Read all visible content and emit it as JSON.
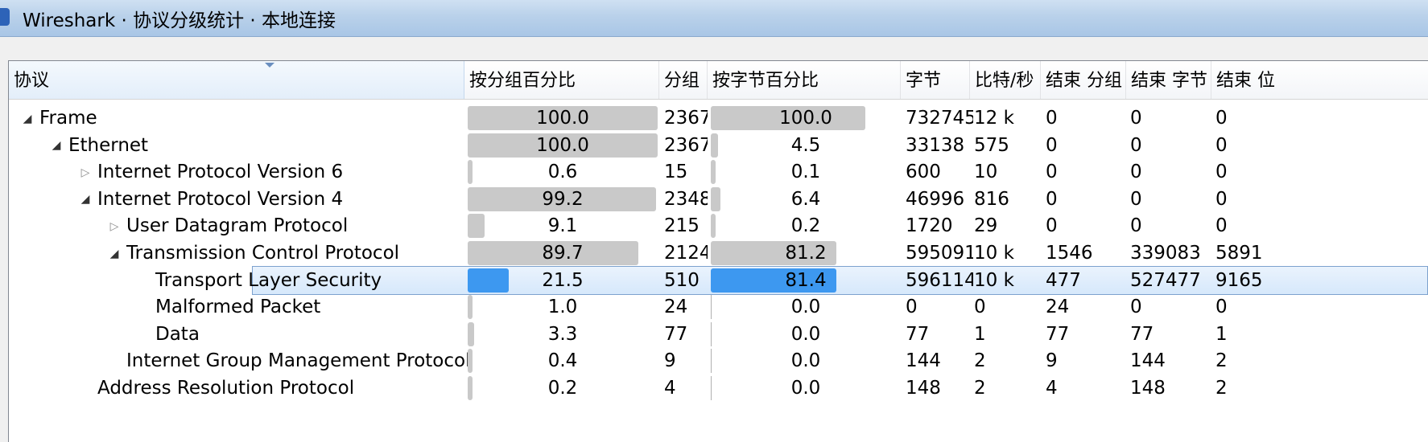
{
  "window": {
    "title": "Wireshark · 协议分级统计 · 本地连接"
  },
  "columns": {
    "protocol": "协议",
    "pct_packets": "按分组百分比",
    "packets": "分组",
    "pct_bytes": "按字节百分比",
    "bytes": "字节",
    "bits_per_sec": "比特/秒",
    "end_packets": "结束 分组",
    "end_bytes": "结束 字节",
    "end_bits": "结束 位"
  },
  "rows": [
    {
      "name": "Frame",
      "depth": 0,
      "expander": "expanded",
      "pct_packets": "100.0",
      "packets": "2367",
      "pct_bytes": "100.0",
      "bytes": "732745",
      "bps": "12 k",
      "end_packets": "0",
      "end_bytes": "0",
      "end_bits": "0",
      "pct_packets_value": 100.0,
      "pct_bytes_value": 100.0,
      "selected": false
    },
    {
      "name": "Ethernet",
      "depth": 1,
      "expander": "expanded",
      "pct_packets": "100.0",
      "packets": "2367",
      "pct_bytes": "4.5",
      "bytes": "33138",
      "bps": "575",
      "end_packets": "0",
      "end_bytes": "0",
      "end_bits": "0",
      "pct_packets_value": 100.0,
      "pct_bytes_value": 4.5,
      "selected": false
    },
    {
      "name": "Internet Protocol Version 6",
      "depth": 2,
      "expander": "collapsed",
      "pct_packets": "0.6",
      "packets": "15",
      "pct_bytes": "0.1",
      "bytes": "600",
      "bps": "10",
      "end_packets": "0",
      "end_bytes": "0",
      "end_bits": "0",
      "pct_packets_value": 0.6,
      "pct_bytes_value": 0.1,
      "selected": false
    },
    {
      "name": "Internet Protocol Version 4",
      "depth": 2,
      "expander": "expanded",
      "pct_packets": "99.2",
      "packets": "2348",
      "pct_bytes": "6.4",
      "bytes": "46996",
      "bps": "816",
      "end_packets": "0",
      "end_bytes": "0",
      "end_bits": "0",
      "pct_packets_value": 99.2,
      "pct_bytes_value": 6.4,
      "selected": false
    },
    {
      "name": "User Datagram Protocol",
      "depth": 3,
      "expander": "collapsed",
      "pct_packets": "9.1",
      "packets": "215",
      "pct_bytes": "0.2",
      "bytes": "1720",
      "bps": "29",
      "end_packets": "0",
      "end_bytes": "0",
      "end_bits": "0",
      "pct_packets_value": 9.1,
      "pct_bytes_value": 0.2,
      "selected": false
    },
    {
      "name": "Transmission Control Protocol",
      "depth": 3,
      "expander": "expanded",
      "pct_packets": "89.7",
      "packets": "2124",
      "pct_bytes": "81.2",
      "bytes": "595091",
      "bps": "10 k",
      "end_packets": "1546",
      "end_bytes": "339083",
      "end_bits": "5891",
      "pct_packets_value": 89.7,
      "pct_bytes_value": 81.2,
      "selected": false
    },
    {
      "name": "Transport Layer Security",
      "depth": 4,
      "expander": "none",
      "pct_packets": "21.5",
      "packets": "510",
      "pct_bytes": "81.4",
      "bytes": "596114",
      "bps": "10 k",
      "end_packets": "477",
      "end_bytes": "527477",
      "end_bits": "9165",
      "pct_packets_value": 21.5,
      "pct_bytes_value": 81.4,
      "selected": true
    },
    {
      "name": "Malformed Packet",
      "depth": 4,
      "expander": "none",
      "pct_packets": "1.0",
      "packets": "24",
      "pct_bytes": "0.0",
      "bytes": "0",
      "bps": "0",
      "end_packets": "24",
      "end_bytes": "0",
      "end_bits": "0",
      "pct_packets_value": 1.0,
      "pct_bytes_value": 0.0,
      "selected": false
    },
    {
      "name": "Data",
      "depth": 4,
      "expander": "none",
      "pct_packets": "3.3",
      "packets": "77",
      "pct_bytes": "0.0",
      "bytes": "77",
      "bps": "1",
      "end_packets": "77",
      "end_bytes": "77",
      "end_bits": "1",
      "pct_packets_value": 3.3,
      "pct_bytes_value": 0.0,
      "selected": false
    },
    {
      "name": "Internet Group Management Protocol",
      "depth": 3,
      "expander": "none",
      "pct_packets": "0.4",
      "packets": "9",
      "pct_bytes": "0.0",
      "bytes": "144",
      "bps": "2",
      "end_packets": "9",
      "end_bytes": "144",
      "end_bits": "2",
      "pct_packets_value": 0.4,
      "pct_bytes_value": 0.0,
      "selected": false
    },
    {
      "name": "Address Resolution Protocol",
      "depth": 2,
      "expander": "none",
      "pct_packets": "0.2",
      "packets": "4",
      "pct_bytes": "0.0",
      "bytes": "148",
      "bps": "2",
      "end_packets": "4",
      "end_bytes": "148",
      "end_bits": "2",
      "pct_packets_value": 0.2,
      "pct_bytes_value": 0.0,
      "selected": false
    }
  ],
  "icons": {
    "expanded": "triangle-down-right-icon",
    "collapsed": "triangle-right-icon",
    "app": "wireshark-fin-icon"
  },
  "colors": {
    "selected_bar": "#3d98f0",
    "bar": "#c9c9c9",
    "selected_row": "#d6e8fb"
  }
}
